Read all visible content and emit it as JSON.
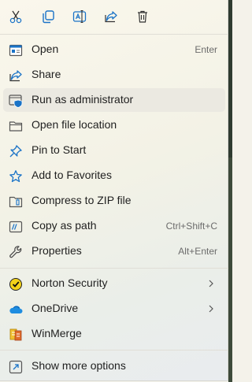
{
  "toolbar": {
    "buttons": [
      {
        "name": "cut",
        "icon": "scissors-icon"
      },
      {
        "name": "copy",
        "icon": "copy-icon"
      },
      {
        "name": "rename",
        "icon": "rename-icon"
      },
      {
        "name": "share",
        "icon": "share-icon"
      },
      {
        "name": "delete",
        "icon": "trash-icon"
      }
    ]
  },
  "menu": {
    "open": {
      "label": "Open",
      "shortcut": "Enter"
    },
    "share": {
      "label": "Share"
    },
    "run_admin": {
      "label": "Run as administrator"
    },
    "open_location": {
      "label": "Open file location"
    },
    "pin_start": {
      "label": "Pin to Start"
    },
    "favorites": {
      "label": "Add to Favorites"
    },
    "compress": {
      "label": "Compress to ZIP file"
    },
    "copy_path": {
      "label": "Copy as path",
      "shortcut": "Ctrl+Shift+C"
    },
    "properties": {
      "label": "Properties",
      "shortcut": "Alt+Enter"
    },
    "norton": {
      "label": "Norton Security"
    },
    "onedrive": {
      "label": "OneDrive"
    },
    "winmerge": {
      "label": "WinMerge"
    },
    "more": {
      "label": "Show more options"
    }
  },
  "colors": {
    "accent": "#1a73c7",
    "norton_yellow": "#f3d31a",
    "onedrive_blue": "#1f8de0"
  }
}
